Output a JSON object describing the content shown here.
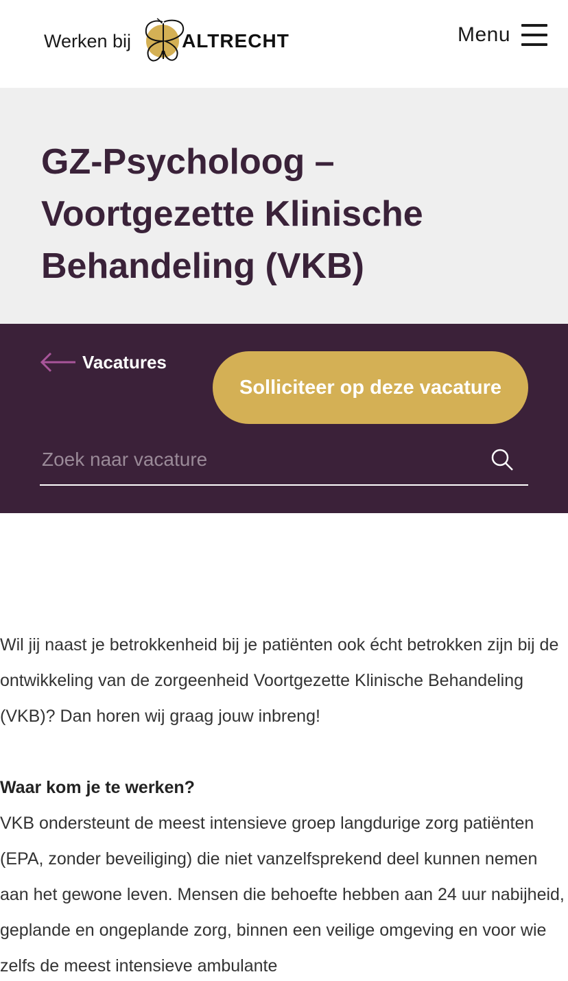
{
  "header": {
    "brand_prefix": "Werken bij",
    "brand_name": "ALTRECHT",
    "menu_label": "Menu"
  },
  "hero": {
    "title": "GZ-Psycholoog – Voortgezette Klinische Behandeling (VKB)"
  },
  "actions": {
    "back_label": "Vacatures",
    "apply_label": "Solliciteer op deze vacature",
    "search_placeholder": "Zoek naar vacature",
    "search_value": ""
  },
  "content": {
    "intro": "Wil jij naast je betrokkenheid bij je patiënten ook écht betrokken zijn bij de ontwikkeling van de zorgeenheid Voortgezette Klinische Behandeling (VKB)? Dan horen wij graag jouw inbreng!",
    "section_heading": "Waar kom je te werken?",
    "section_text": "VKB ondersteunt de meest intensieve groep langdurige zorg patiënten (EPA, zonder beveiliging) die niet vanzelfsprekend deel kunnen nemen aan het gewone leven. Mensen die behoefte hebben aan 24 uur nabijheid, geplande en ongeplande zorg, binnen een veilige omgeving en voor wie zelfs de meest intensieve ambulante"
  },
  "colors": {
    "brand_purple": "#3b2139",
    "title_purple": "#3a2239",
    "accent_gold": "#d4b055",
    "hero_bg": "#efefef"
  },
  "icons": [
    "butterfly-logo-icon",
    "hamburger-icon",
    "arrow-left-icon",
    "search-icon"
  ]
}
